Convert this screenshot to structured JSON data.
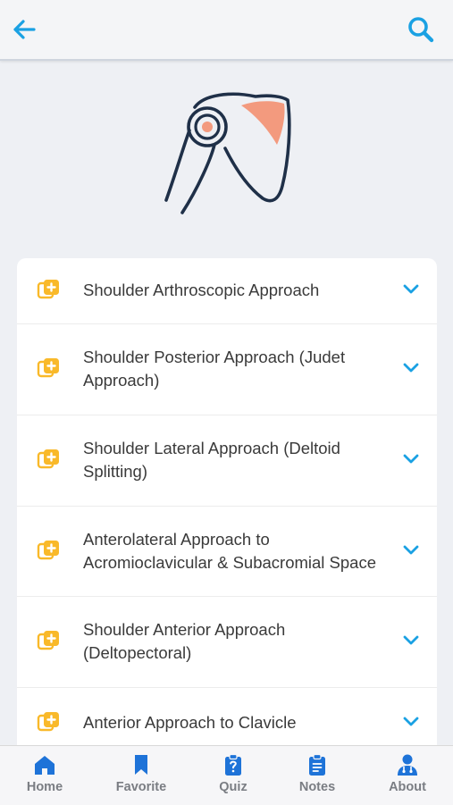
{
  "colors": {
    "accent": "#1aa1e3",
    "icon_orange": "#f9b92a",
    "nav_active": "#1e73d8",
    "text": "#3a3a3a",
    "muted": "#7a7d83",
    "hero_stroke": "#1f3048",
    "hero_highlight": "#f39a7e"
  },
  "header": {
    "back_icon": "arrow-left",
    "search_icon": "search"
  },
  "hero": {
    "icon": "shoulder-joint-illustration"
  },
  "approaches": [
    {
      "label_lines": [
        "Shoulder Arthroscopic Approach"
      ]
    },
    {
      "label_lines": [
        "Shoulder Posterior Approach (Judet",
        "Approach)"
      ]
    },
    {
      "label_lines": [
        "Shoulder Lateral Approach (Deltoid",
        "Splitting)"
      ]
    },
    {
      "label_lines": [
        "Anterolateral Approach to",
        "Acromioclavicular & Subacromial Space"
      ]
    },
    {
      "label_lines": [
        "Shoulder Anterior Approach",
        "(Deltopectoral)"
      ]
    },
    {
      "label_lines": [
        "Anterior Approach to Clavicle"
      ]
    }
  ],
  "nav": [
    {
      "label": "Home",
      "icon": "home"
    },
    {
      "label": "Favorite",
      "icon": "bookmark"
    },
    {
      "label": "Quiz",
      "icon": "quiz-clipboard"
    },
    {
      "label": "Notes",
      "icon": "notes-clipboard"
    },
    {
      "label": "About",
      "icon": "doctor"
    }
  ]
}
